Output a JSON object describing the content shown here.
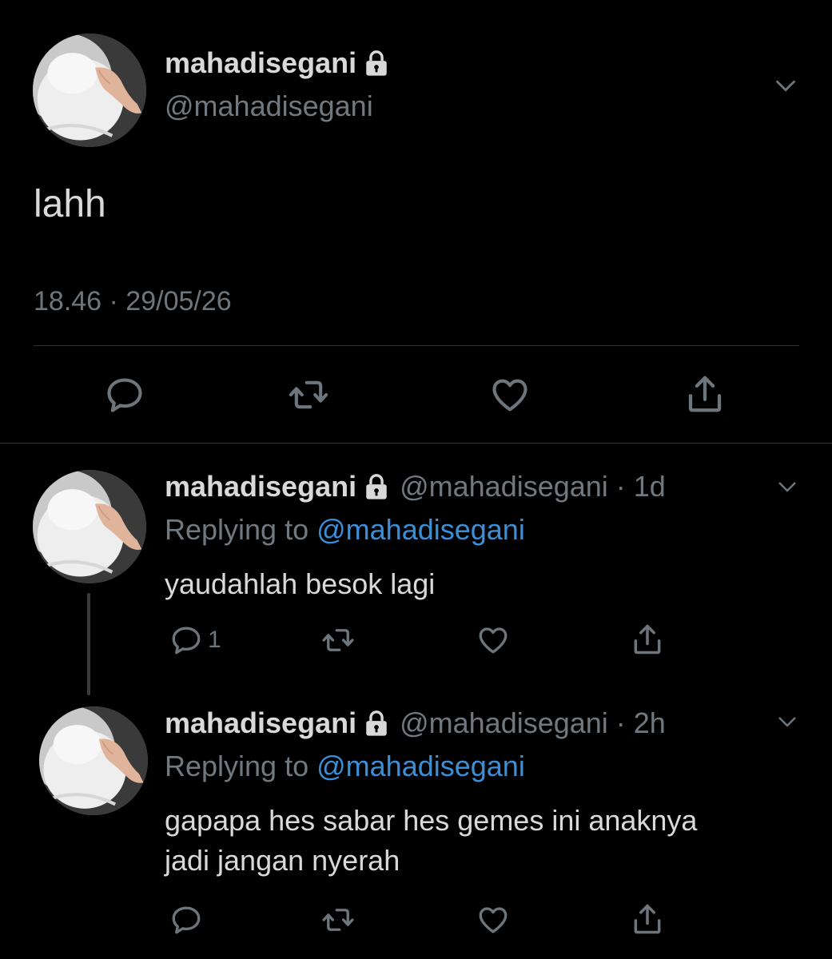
{
  "main_tweet": {
    "display_name": "mahadisegani",
    "handle": "@mahadisegani",
    "text": "lahh",
    "timestamp": "18.46 · 29/05/26",
    "locked": true
  },
  "replies": [
    {
      "display_name": "mahadisegani",
      "handle_time": "@mahadisegani · 1d",
      "replying_prefix": "Replying to",
      "replying_to": "@mahadisegani",
      "text": "yaudahlah besok lagi",
      "reply_count": "1"
    },
    {
      "display_name": "mahadisegani",
      "handle_time": "@mahadisegani · 2h",
      "replying_prefix": "Replying to",
      "replying_to": "@mahadisegani",
      "text_line1": "gapapa hes sabar hes gemes ini anaknya",
      "text_line2": "jadi jangan nyerah",
      "reply_count": ""
    }
  ],
  "icons": [
    "avatar-image",
    "lock-icon",
    "chevron-down-icon",
    "reply-icon",
    "retweet-icon",
    "like-icon",
    "share-icon"
  ],
  "colors": {
    "background": "#000000",
    "text": "#d9d9d9",
    "muted": "#6e767d",
    "link": "#3b8fd8",
    "divider": "#2f3336"
  }
}
